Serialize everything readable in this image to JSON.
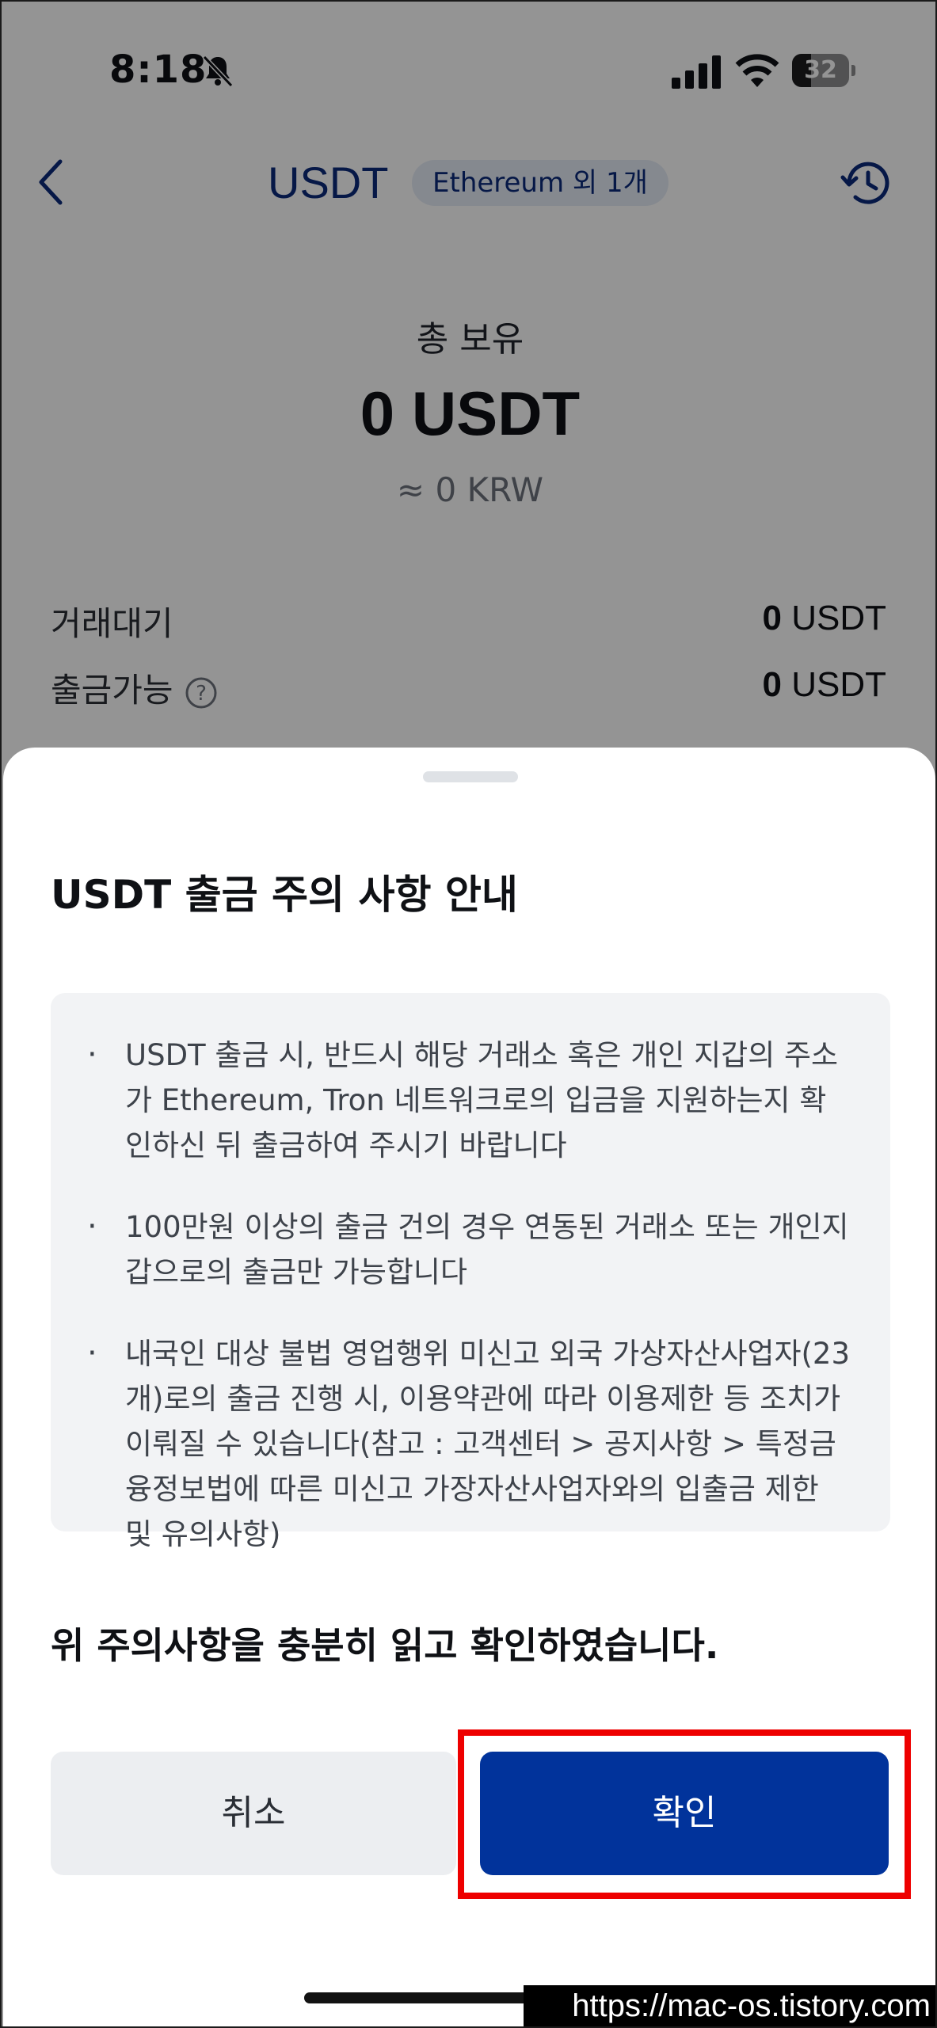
{
  "status_bar": {
    "time": "8:18",
    "battery": "32"
  },
  "header": {
    "title": "USDT",
    "network_chip": "Ethereum 외 1개"
  },
  "balance": {
    "total_label": "총 보유",
    "total_amount": "0 USDT",
    "total_krw": "≈ 0 KRW",
    "rows": [
      {
        "label": "거래대기",
        "amount": "0",
        "unit": " USDT"
      },
      {
        "label": "출금가능",
        "amount": "0",
        "unit": " USDT"
      }
    ]
  },
  "sheet": {
    "title": "USDT 출금 주의 사항 안내",
    "notices": [
      "USDT 출금 시, 반드시 해당 거래소 혹은 개인 지갑의 주소가 Ethereum, Tron 네트워크로의 입금을 지원하는지 확인하신 뒤 출금하여 주시기 바랍니다",
      "100만원 이상의 출금 건의 경우 연동된 거래소 또는 개인지갑으로의 출금만 가능합니다",
      "내국인 대상 불법 영업행위 미신고 외국 가상자산사업자(23개)로의 출금 진행 시, 이용약관에 따라 이용제한 등 조치가 이뤄질 수 있습니다(참고 : 고객센터 > 공지사항 > 특정금융정보법에 따른 미신고 가장자산사업자와의 입출금 제한 및 유의사항)"
    ],
    "confirm_text": "위 주의사항을 충분히 읽고 확인하였습니다.",
    "cancel_label": "취소",
    "ok_label": "확인"
  },
  "watermark": "https://mac-os.tistory.com",
  "colors": {
    "primary": "#01339b",
    "highlight": "#ee0000",
    "title_blue": "#0b2a7a"
  }
}
